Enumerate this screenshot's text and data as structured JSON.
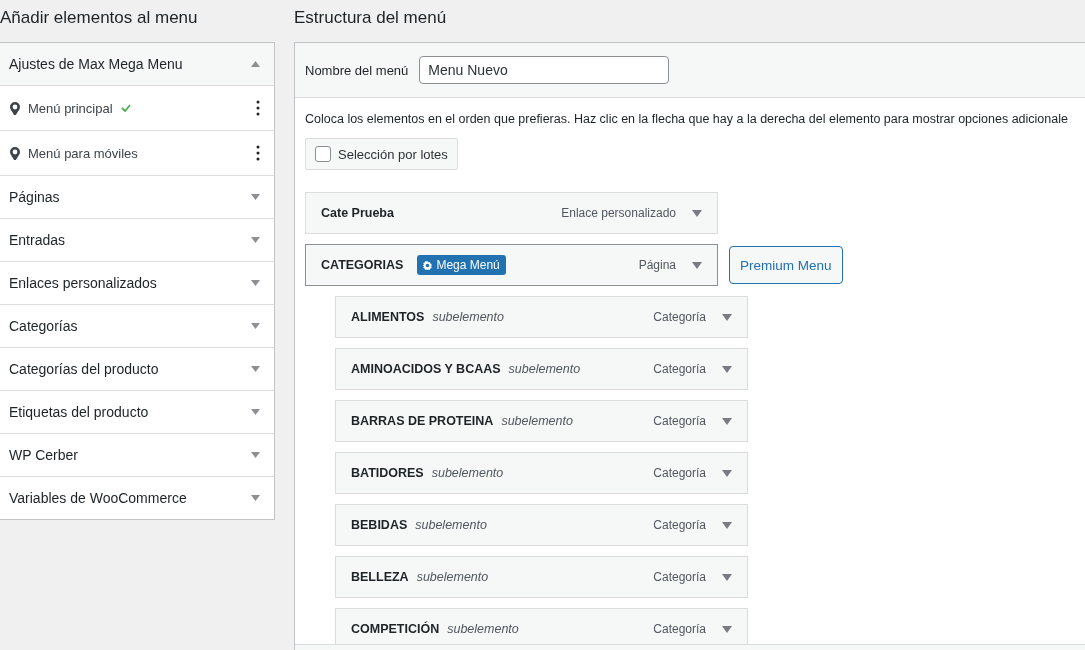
{
  "left": {
    "title": "Añadir elementos al menu",
    "sections": [
      {
        "label": "Ajustes de Max Mega Menu",
        "expanded": true,
        "locations": [
          {
            "name": "Menú principal",
            "checked": true
          },
          {
            "name": "Menú para móviles",
            "checked": false
          }
        ]
      },
      {
        "label": "Páginas",
        "expanded": false
      },
      {
        "label": "Entradas",
        "expanded": false
      },
      {
        "label": "Enlaces personalizados",
        "expanded": false
      },
      {
        "label": "Categorías",
        "expanded": false
      },
      {
        "label": "Categorías del producto",
        "expanded": false
      },
      {
        "label": "Etiquetas del producto",
        "expanded": false
      },
      {
        "label": "WP Cerber",
        "expanded": false
      },
      {
        "label": "Variables de WooCommerce",
        "expanded": false
      }
    ]
  },
  "right": {
    "title": "Estructura del menú",
    "name_label": "Nombre del menú",
    "name_value": "Menu Nuevo",
    "instructions": "Coloca los elementos en el orden que prefieras. Haz clic en la flecha que hay a la derecha del elemento para mostrar opciones adicionale",
    "bulk": {
      "label": "Selección por lotes",
      "checked": false
    },
    "items": [
      {
        "title": "Cate Prueba",
        "type": "Enlace personalizado",
        "selected": false
      },
      {
        "title": "CATEGORIAS",
        "badge": "Mega Menú",
        "type": "Página",
        "selected": true,
        "side_button": "Premium Menu",
        "children": [
          {
            "title": "ALIMENTOS",
            "note": "subelemento",
            "type": "Categoría"
          },
          {
            "title": "AMINOACIDOS Y BCAAS",
            "note": "subelemento",
            "type": "Categoría"
          },
          {
            "title": "BARRAS DE PROTEINA",
            "note": "subelemento",
            "type": "Categoría"
          },
          {
            "title": "BATIDORES",
            "note": "subelemento",
            "type": "Categoría"
          },
          {
            "title": "BEBIDAS",
            "note": "subelemento",
            "type": "Categoría"
          },
          {
            "title": "BELLEZA",
            "note": "subelemento",
            "type": "Categoría"
          },
          {
            "title": "COMPETICIÓN",
            "note": "subelemento",
            "type": "Categoría"
          }
        ]
      }
    ]
  }
}
